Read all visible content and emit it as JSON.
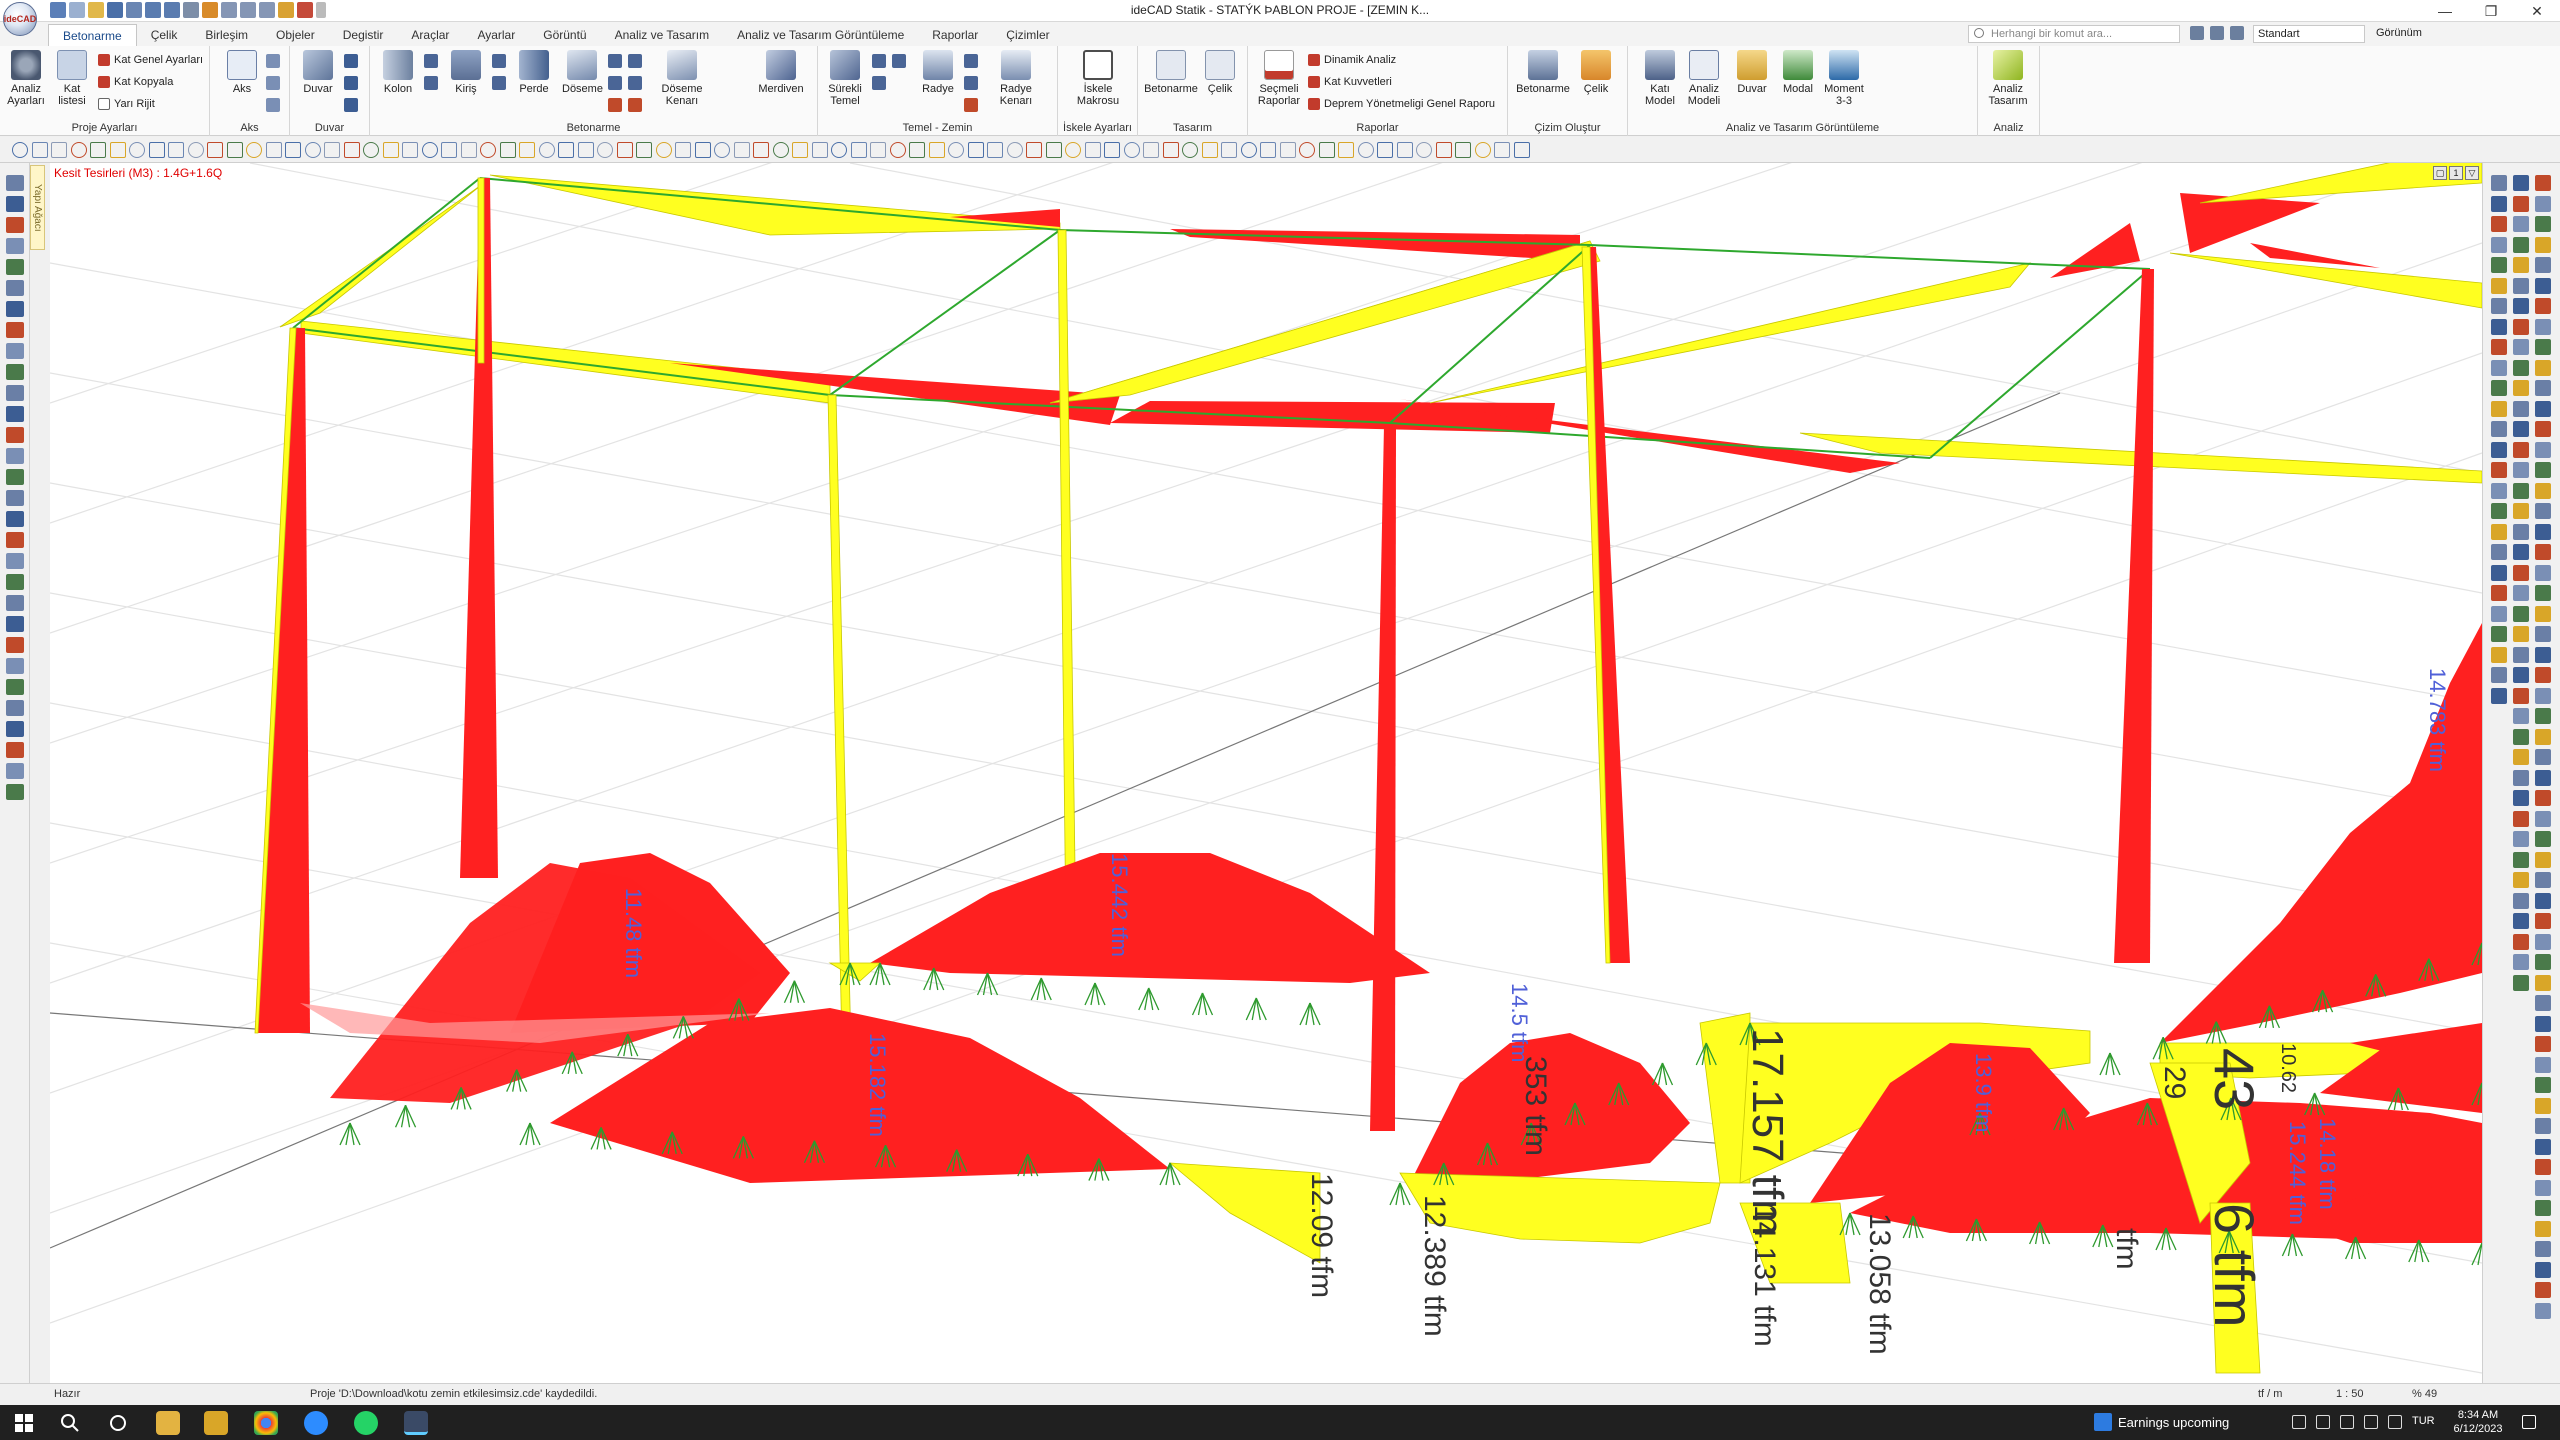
{
  "window": {
    "title": "ideCAD Statik - STATÝK ÞABLON PROJE - [ZEMIN K...",
    "logo_text": "ideCAD",
    "controls": [
      "—",
      "❐",
      "✕"
    ]
  },
  "ribbon_tabs": [
    "Betonarme",
    "Çelik",
    "Birleşim",
    "Objeler",
    "Degistir",
    "Araçlar",
    "Ayarlar",
    "Görüntü",
    "Analiz ve Tasarım",
    "Analiz ve Tasarım Görüntüleme",
    "Raporlar",
    "Çizimler"
  ],
  "search": {
    "placeholder": "Herhangi bir komut ara..."
  },
  "style_dropdown": "Standart",
  "view_menu": "Görünüm",
  "ribbon": {
    "proje_ayarlari": {
      "label": "Proje Ayarları",
      "analiz_ayarlari": "Analiz Ayarları",
      "kat_listesi": "Kat listesi",
      "kat_genel_ayarlari": "Kat Genel Ayarları",
      "kat_kopyala": "Kat Kopyala",
      "yari_rijit": "Yarı Rijit"
    },
    "aks": {
      "label": "Aks",
      "aks_btn": "Aks"
    },
    "duvar": {
      "label": "Duvar",
      "duvar_btn": "Duvar"
    },
    "betonarme": {
      "label": "Betonarme",
      "kolon": "Kolon",
      "kiris": "Kiriş",
      "perde": "Perde",
      "doseme": "Döseme",
      "doseme_kenari": "Döseme Kenarı",
      "merdiven": "Merdiven"
    },
    "temel": {
      "label": "Temel - Zemin",
      "surekli_temel": "Sürekli Temel",
      "radye": "Radye",
      "radye_kenari": "Radye Kenarı"
    },
    "iskele": {
      "label": "İskele Ayarları",
      "iskele_makrosu": "İskele Makrosu"
    },
    "tasarim": {
      "label": "Tasarım",
      "betonarme": "Betonarme",
      "celik": "Çelik"
    },
    "raporlar": {
      "label": "Raporlar",
      "secmeli_raporlar": "Seçmeli Raporlar",
      "dinamik_analiz": "Dinamik Analiz",
      "kat_kuvvetleri": "Kat Kuvvetleri",
      "deprem_raporu": "Deprem Yönetmeligi Genel Raporu"
    },
    "cizim_olustur": {
      "label": "Çizim Oluştur",
      "betonarme": "Betonarme",
      "celik": "Çelik"
    },
    "analiz_gorunum": {
      "label": "Analiz ve Tasarım Görüntüleme",
      "kati_model": "Katı Model",
      "analiz_modeli": "Analiz Modeli",
      "duvar": "Duvar",
      "modal": "Modal",
      "moment": "Moment 3-3"
    },
    "analiz": {
      "label": "Analiz",
      "analiz_tasarim": "Analiz Tasarım"
    }
  },
  "side_panel_tab": "Yapı Ağacı",
  "viewport": {
    "combo_label": "Kesit Tesirleri (M3) : 1.4G+1.6Q",
    "corner_buttons": [
      "▢",
      "1",
      "▽"
    ],
    "colors": {
      "positive": "#ff2020",
      "negative": "#ffff20",
      "beam": "#2ea82e",
      "springs": "#2e9a2e",
      "value_text": "#5060d8"
    },
    "value_labels": [
      "12.09 tfm",
      "12.389 tfm",
      "14.131 tfm",
      "13.058 tfm",
      "17.157 tfm",
      "353 tfm",
      "29",
      "43",
      "6 tfm",
      "10.62",
      "tfm"
    ],
    "rotated_labels": [
      "11.48 tfm",
      "15.442 tfm",
      "15.182 tfm",
      "14.18 tfm",
      "14.783 tfm",
      "15.244 tfm",
      "14.5 tfm",
      "13.9 tfm"
    ]
  },
  "status": {
    "state": "Hazır",
    "message": "Proje 'D:\\Download\\kotu zemin etkilesimsiz.cde' kaydedildi.",
    "unit": "tf / m",
    "scale": "1 : 50",
    "zoom": "% 49"
  },
  "taskbar": {
    "notification": "Earnings upcoming",
    "language": "TUR",
    "time": "8:34 AM",
    "date": "6/12/2023"
  }
}
